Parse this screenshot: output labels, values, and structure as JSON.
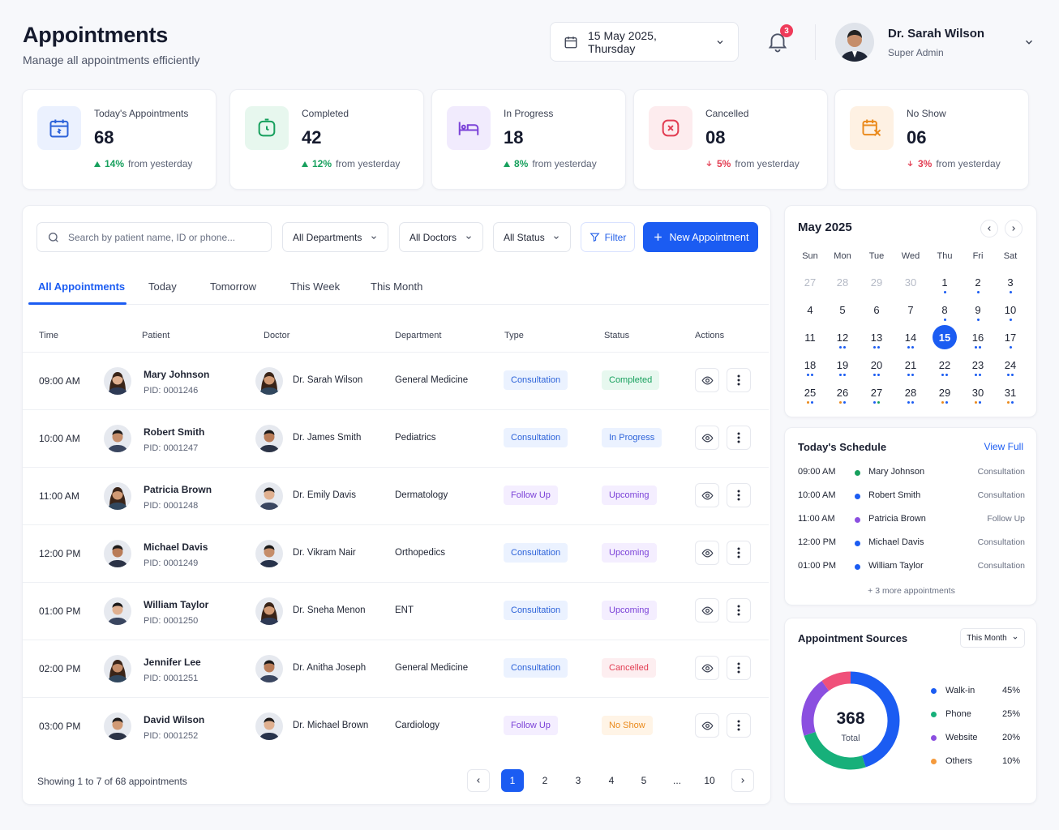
{
  "header": {
    "title": "Appointments",
    "subtitle": "Manage all appointments efficiently",
    "date": "15 May 2025, Thursday",
    "notifications": "3"
  },
  "user": {
    "name": "Dr. Sarah Wilson",
    "role": "Super Admin"
  },
  "stats": [
    {
      "label": "Today's Appointments",
      "value": "68",
      "change": "14%",
      "suffix": "from yesterday",
      "dir": "up",
      "icon": "calendar-icon",
      "color": "#2d63d9",
      "bg": "#ebf1fe"
    },
    {
      "label": "Completed",
      "value": "42",
      "change": "12%",
      "suffix": "from yesterday",
      "dir": "up",
      "icon": "check-clock-icon",
      "color": "#17a05d",
      "bg": "#e7f7ee"
    },
    {
      "label": "In Progress",
      "value": "18",
      "change": "8%",
      "suffix": "from yesterday",
      "dir": "up",
      "icon": "bed-icon",
      "color": "#7b42d8",
      "bg": "#f1ebfd"
    },
    {
      "label": "Cancelled",
      "value": "08",
      "change": "5%",
      "suffix": "from yesterday",
      "dir": "down",
      "icon": "cancel-icon",
      "color": "#e23d52",
      "bg": "#fdecee"
    },
    {
      "label": "No Show",
      "value": "06",
      "change": "3%",
      "suffix": "from yesterday",
      "dir": "down",
      "icon": "no-show-icon",
      "color": "#ea8a1c",
      "bg": "#fef1e3"
    }
  ],
  "toolbar": {
    "search_placeholder": "Search by patient name, ID or phone...",
    "departments": "All Departments",
    "doctors": "All Doctors",
    "status": "All Status",
    "filter": "Filter",
    "new": "New Appointment"
  },
  "tabs": [
    "All Appointments",
    "Today",
    "Tomorrow",
    "This Week",
    "This Month"
  ],
  "columns": [
    "Time",
    "Patient",
    "Doctor",
    "Department",
    "Type",
    "Status",
    "Actions"
  ],
  "appointments": [
    {
      "time": "09:00 AM",
      "patient": "Mary Johnson",
      "pid": "PID: 0001246",
      "doctor": "Dr. Sarah Wilson",
      "department": "General Medicine",
      "type": "Consultation",
      "status": "Completed"
    },
    {
      "time": "10:00 AM",
      "patient": "Robert Smith",
      "pid": "PID: 0001247",
      "doctor": "Dr. James Smith",
      "department": "Pediatrics",
      "type": "Consultation",
      "status": "In Progress"
    },
    {
      "time": "11:00 AM",
      "patient": "Patricia Brown",
      "pid": "PID: 0001248",
      "doctor": "Dr. Emily Davis",
      "department": "Dermatology",
      "type": "Follow Up",
      "status": "Upcoming"
    },
    {
      "time": "12:00 PM",
      "patient": "Michael Davis",
      "pid": "PID: 0001249",
      "doctor": "Dr. Vikram Nair",
      "department": "Orthopedics",
      "type": "Consultation",
      "status": "Upcoming"
    },
    {
      "time": "01:00 PM",
      "patient": "William Taylor",
      "pid": "PID: 0001250",
      "doctor": "Dr. Sneha Menon",
      "department": "ENT",
      "type": "Consultation",
      "status": "Upcoming"
    },
    {
      "time": "02:00 PM",
      "patient": "Jennifer Lee",
      "pid": "PID: 0001251",
      "doctor": "Dr. Anitha Joseph",
      "department": "General Medicine",
      "type": "Consultation",
      "status": "Cancelled"
    },
    {
      "time": "03:00 PM",
      "patient": "David Wilson",
      "pid": "PID: 0001252",
      "doctor": "Dr. Michael Brown",
      "department": "Cardiology",
      "type": "Follow Up",
      "status": "No Show"
    }
  ],
  "pagination": {
    "summary": "Showing 1 to 7 of 68 appointments",
    "pages": [
      "1",
      "2",
      "3",
      "4",
      "5",
      "...",
      "10"
    ],
    "current": "1"
  },
  "calendar": {
    "month": "May 2025",
    "weekdays": [
      "Sun",
      "Mon",
      "Tue",
      "Wed",
      "Thu",
      "Fri",
      "Sat"
    ],
    "days": [
      {
        "d": "27",
        "m": true
      },
      {
        "d": "28",
        "m": true
      },
      {
        "d": "29",
        "m": true
      },
      {
        "d": "30",
        "m": true
      },
      {
        "d": "1",
        "dots": [
          "#1b5cf2"
        ]
      },
      {
        "d": "2",
        "dots": [
          "#1b5cf2"
        ]
      },
      {
        "d": "3",
        "dots": [
          "#1b5cf2"
        ]
      },
      {
        "d": "4"
      },
      {
        "d": "5"
      },
      {
        "d": "6"
      },
      {
        "d": "7"
      },
      {
        "d": "8",
        "dots": [
          "#1b5cf2"
        ]
      },
      {
        "d": "9",
        "dots": [
          "#1b5cf2"
        ]
      },
      {
        "d": "10",
        "dots": [
          "#1b5cf2"
        ]
      },
      {
        "d": "11"
      },
      {
        "d": "12",
        "dots": [
          "#1b5cf2",
          "#1b5cf2"
        ]
      },
      {
        "d": "13",
        "dots": [
          "#1b5cf2",
          "#1b5cf2"
        ]
      },
      {
        "d": "14",
        "dots": [
          "#1b5cf2",
          "#1b5cf2"
        ]
      },
      {
        "d": "15",
        "today": true
      },
      {
        "d": "16",
        "dots": [
          "#1b5cf2",
          "#1b5cf2"
        ]
      },
      {
        "d": "17",
        "dots": [
          "#1b5cf2"
        ]
      },
      {
        "d": "18",
        "dots": [
          "#1b5cf2",
          "#1b5cf2"
        ]
      },
      {
        "d": "19",
        "dots": [
          "#1b5cf2",
          "#1b5cf2"
        ]
      },
      {
        "d": "20",
        "dots": [
          "#1b5cf2",
          "#1b5cf2"
        ]
      },
      {
        "d": "21",
        "dots": [
          "#1b5cf2",
          "#1b5cf2"
        ]
      },
      {
        "d": "22",
        "dots": [
          "#1b5cf2",
          "#1b5cf2"
        ]
      },
      {
        "d": "23",
        "dots": [
          "#1b5cf2",
          "#1b5cf2"
        ]
      },
      {
        "d": "24",
        "dots": [
          "#1b5cf2",
          "#1b5cf2"
        ]
      },
      {
        "d": "25",
        "dots": [
          "#ea8a1c",
          "#1b5cf2"
        ]
      },
      {
        "d": "26",
        "dots": [
          "#ea8a1c",
          "#1b5cf2"
        ]
      },
      {
        "d": "27",
        "dots": [
          "#1b5cf2",
          "#17a05d"
        ]
      },
      {
        "d": "28",
        "dots": [
          "#1b5cf2",
          "#1b5cf2"
        ]
      },
      {
        "d": "29",
        "dots": [
          "#ea8a1c",
          "#1b5cf2"
        ]
      },
      {
        "d": "30",
        "dots": [
          "#ea8a1c",
          "#1b5cf2"
        ]
      },
      {
        "d": "31",
        "dots": [
          "#ea8a1c",
          "#1b5cf2"
        ]
      }
    ]
  },
  "schedule": {
    "title": "Today's Schedule",
    "view_full": "View Full",
    "items": [
      {
        "time": "09:00 AM",
        "name": "Mary Johnson",
        "type": "Consultation",
        "color": "#17a05d"
      },
      {
        "time": "10:00 AM",
        "name": "Robert Smith",
        "type": "Consultation",
        "color": "#1b5cf2"
      },
      {
        "time": "11:00 AM",
        "name": "Patricia Brown",
        "type": "Follow Up",
        "color": "#8b4fe0"
      },
      {
        "time": "12:00 PM",
        "name": "Michael Davis",
        "type": "Consultation",
        "color": "#1b5cf2"
      },
      {
        "time": "01:00 PM",
        "name": "William Taylor",
        "type": "Consultation",
        "color": "#1b5cf2"
      }
    ],
    "more": "+ 3 more appointments"
  },
  "sources": {
    "title": "Appointment Sources",
    "period": "This Month",
    "total": "368",
    "total_label": "Total",
    "chart_data": {
      "type": "pie",
      "categories": [
        "Walk-in",
        "Phone",
        "Website",
        "Others"
      ],
      "values": [
        45,
        25,
        20,
        10
      ],
      "labels": [
        "45%",
        "25%",
        "20%",
        "10%"
      ],
      "colors": [
        "#1b5cf2",
        "#17b07a",
        "#8b4fe0",
        "#f0507a"
      ],
      "legend_colors": [
        "#1b5cf2",
        "#17b07a",
        "#8b4fe0",
        "#f59a3c"
      ]
    }
  }
}
